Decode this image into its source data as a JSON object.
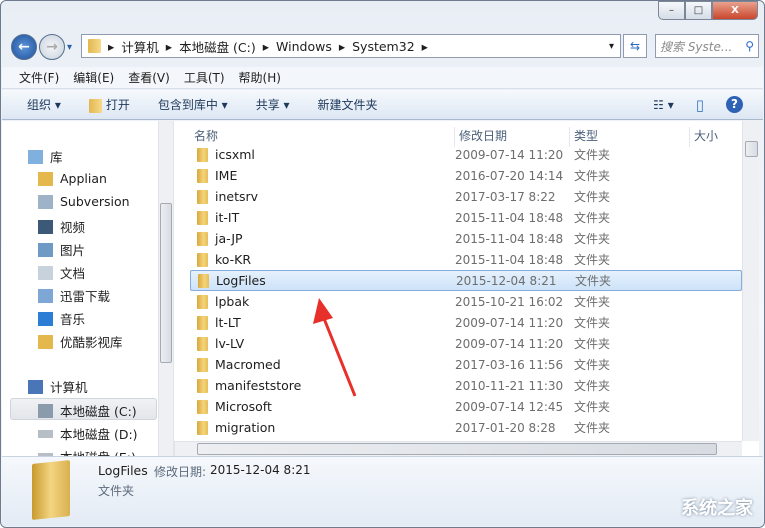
{
  "window": {
    "minimize": "–",
    "maximize": "□",
    "close": "X"
  },
  "nav": {
    "back": "←",
    "forward": "→",
    "history": "▾"
  },
  "address": {
    "crumbs": [
      "计算机",
      "本地磁盘 (C:)",
      "Windows",
      "System32"
    ],
    "separator": "▸",
    "dropdown": "▾",
    "refresh": "⇆"
  },
  "search": {
    "placeholder": "搜索 Syste...",
    "icon": "⚲"
  },
  "menu": [
    "文件(F)",
    "编辑(E)",
    "查看(V)",
    "工具(T)",
    "帮助(H)"
  ],
  "toolbar": {
    "organize": "组织 ▾",
    "open": "打开",
    "include": "包含到库中 ▾",
    "share": "共享 ▾",
    "new_folder": "新建文件夹",
    "views": "☷ ▾",
    "preview": "▯",
    "help": "?"
  },
  "sidebar": {
    "library": "库",
    "items": [
      "Applian",
      "Subversion",
      "视频",
      "图片",
      "文档",
      "迅雷下载",
      "音乐",
      "优酷影视库"
    ],
    "computer": "计算机",
    "drives": [
      "本地磁盘 (C:)",
      "本地磁盘 (D:)",
      "本地磁盘 (E:)"
    ]
  },
  "columns": {
    "name": "名称",
    "date": "修改日期",
    "type": "类型",
    "size": "大小"
  },
  "files": [
    {
      "name": "icsxml",
      "date": "2009-07-14 11:20",
      "type": "文件夹"
    },
    {
      "name": "IME",
      "date": "2016-07-20 14:14",
      "type": "文件夹"
    },
    {
      "name": "inetsrv",
      "date": "2017-03-17 8:22",
      "type": "文件夹"
    },
    {
      "name": "it-IT",
      "date": "2015-11-04 18:48",
      "type": "文件夹"
    },
    {
      "name": "ja-JP",
      "date": "2015-11-04 18:48",
      "type": "文件夹"
    },
    {
      "name": "ko-KR",
      "date": "2015-11-04 18:48",
      "type": "文件夹"
    },
    {
      "name": "LogFiles",
      "date": "2015-12-04 8:21",
      "type": "文件夹"
    },
    {
      "name": "lpbak",
      "date": "2015-10-21 16:02",
      "type": "文件夹"
    },
    {
      "name": "lt-LT",
      "date": "2009-07-14 11:20",
      "type": "文件夹"
    },
    {
      "name": "lv-LV",
      "date": "2009-07-14 11:20",
      "type": "文件夹"
    },
    {
      "name": "Macromed",
      "date": "2017-03-16 11:56",
      "type": "文件夹"
    },
    {
      "name": "manifeststore",
      "date": "2010-11-21 11:30",
      "type": "文件夹"
    },
    {
      "name": "Microsoft",
      "date": "2009-07-14 12:45",
      "type": "文件夹"
    },
    {
      "name": "migration",
      "date": "2017-01-20 8:28",
      "type": "文件夹"
    }
  ],
  "details": {
    "name": "LogFiles",
    "date_label": "修改日期:",
    "date": "2015-12-04 8:21",
    "type": "文件夹"
  },
  "watermark": "系统之家"
}
